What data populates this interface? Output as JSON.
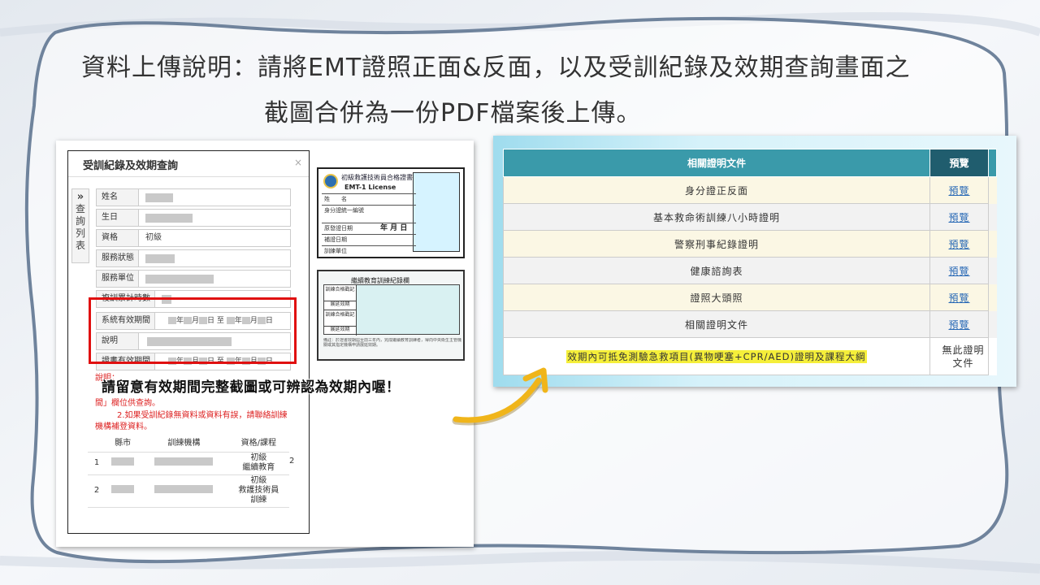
{
  "heading": {
    "line1": "資料上傳說明：請將EMT證照正面&反面，以及受訓紀錄及效期查詢畫面之",
    "line2": "截圖合併為一份PDF檔案後上傳。"
  },
  "query_panel": {
    "title": "受訓紀錄及效期查詢",
    "close": "×",
    "side_tab_icon": "»",
    "side_tab_text": "查詢列表",
    "fields": {
      "name": "姓名",
      "birthday": "生日",
      "qualification": "資格",
      "qualification_value": "初級",
      "service_status": "服務狀態",
      "service_unit": "服務單位",
      "retrain_hours": "複訓累計時數",
      "system_validity": "系統有效期間",
      "note": "說明",
      "cert_validity": "證書有效期間"
    },
    "date_parts": {
      "year": "年",
      "month": "月",
      "day": "日",
      "to": "至"
    },
    "red_notes": [
      "說明：",
      "間」欄位供查詢。",
      "2.如果受訓紀錄無資料或資料有誤，請聯絡訓練",
      "機構補登資料。"
    ],
    "table": {
      "headers": [
        "縣市",
        "訓練機構",
        "資格/課程"
      ],
      "rows": [
        {
          "index": "1",
          "course_line1": "初級",
          "course_line2": "繼續教育",
          "extra": "2"
        },
        {
          "index": "2",
          "course_line1": "初級",
          "course_line2": "救護技術員",
          "course_line3": "訓練"
        }
      ]
    }
  },
  "callout": "請留意有效期間完整截圖或可辨認為效期內喔！",
  "license_front": {
    "title": "初級救護技術員合格證書",
    "subtitle": "EMT-1 License",
    "rows": [
      "姓　　名",
      "身分證統一編號",
      "原發證日期",
      "補證日期",
      "訓練單位"
    ],
    "year": "年",
    "month": "月",
    "day": "日"
  },
  "license_back": {
    "title": "繼續教育訓練紀錄欄",
    "rows": [
      "訓練合格戳記",
      "展延效期",
      "訓練合格戳記",
      "展延效期"
    ],
    "fine_print": "備註：於證書效期屆至前三年內，完成繼續教育訓練者，得向中央衛生主管機關或其指定機構申請展延效期。"
  },
  "docs_panel": {
    "header_doc": "相關證明文件",
    "header_preview": "預覽",
    "preview_link": "預覽",
    "rows": [
      "身分證正反面",
      "基本救命術訓練八小時證明",
      "警察刑事紀錄證明",
      "健康諮詢表",
      "證照大頭照",
      "相關證明文件"
    ],
    "last_row": "效期內可抵免測驗急救項目(異物哽塞+CPR/AED)證明及課程大綱",
    "last_preview_line1": "無此證明",
    "last_preview_line2": "文件"
  },
  "colors": {
    "header_teal": "#3a9aaa",
    "header_dark": "#205d6e",
    "highlight": "#f5ef3a",
    "red_box": "#e01010",
    "arrow": "#f0b51a"
  }
}
